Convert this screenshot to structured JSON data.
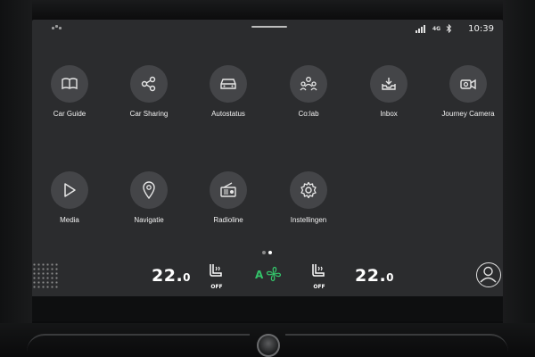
{
  "status": {
    "network": "4G",
    "time": "10:39"
  },
  "apps": [
    {
      "label": "Car Guide",
      "icon": "book-icon"
    },
    {
      "label": "Car Sharing",
      "icon": "share-icon"
    },
    {
      "label": "Autostatus",
      "icon": "car-icon"
    },
    {
      "label": "Co:lab",
      "icon": "community-icon"
    },
    {
      "label": "Inbox",
      "icon": "inbox-download-icon"
    },
    {
      "label": "Journey Camera",
      "icon": "camera-icon"
    },
    {
      "label": "Media",
      "icon": "play-icon"
    },
    {
      "label": "Navigatie",
      "icon": "map-pin-icon"
    },
    {
      "label": "Radioline",
      "icon": "radio-icon"
    },
    {
      "label": "Instellingen",
      "icon": "gear-icon"
    }
  ],
  "pager": {
    "total": 2,
    "active": 2
  },
  "climate": {
    "left_temp": "22.",
    "left_temp_decimal": "0",
    "right_temp": "22.",
    "right_temp_decimal": "0",
    "left_seat_label": "OFF",
    "right_seat_label": "OFF",
    "fan_mode": "A",
    "fan_color": "#34c46a"
  },
  "colors": {
    "screen_bg": "#2b2c2e",
    "app_circle": "#444548"
  }
}
